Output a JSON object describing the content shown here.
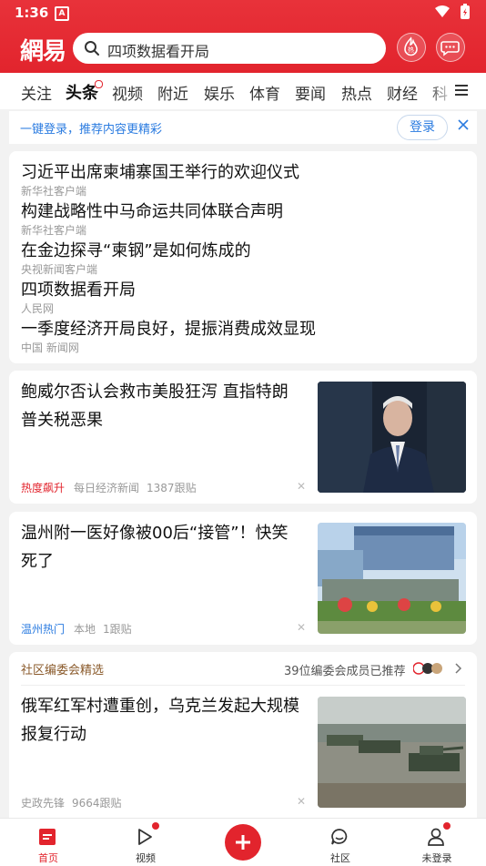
{
  "status_bar": {
    "time": "1:36",
    "notif_icon": "A"
  },
  "header": {
    "logo": "網易",
    "search_placeholder": "四项数据看开局",
    "hot_icon_label": "热"
  },
  "tabs": [
    "关注",
    "头条",
    "视频",
    "附近",
    "娱乐",
    "体育",
    "要闻",
    "热点",
    "财经",
    "科"
  ],
  "login_banner": {
    "text": "一键登录，推荐内容更精彩",
    "button": "登录"
  },
  "headlines": [
    {
      "title": "习近平出席柬埔寨国王举行的欢迎仪式",
      "source": "新华社客户端"
    },
    {
      "title": "构建战略性中马命运共同体联合声明",
      "source": "新华社客户端"
    },
    {
      "title": "在金边探寻“柬钢”是如何炼成的",
      "source": "央视新闻客户端"
    },
    {
      "title": "四项数据看开局",
      "source": "人民网"
    },
    {
      "title": "一季度经济开局良好，提振消费成效显现",
      "source": "中国 新闻网"
    }
  ],
  "news": [
    {
      "title": "鲍威尔否认会救市美股狂泻 直指特朗普关税恶果",
      "tag": "热度飙升",
      "source": "每日经济新闻",
      "comments": "1387跟贴"
    },
    {
      "title": "温州附一医好像被00后“接管”！快笑死了",
      "tag": "温州热门",
      "source": "本地",
      "comments": "1跟贴"
    }
  ],
  "community": {
    "label": "社区编委会精选",
    "recommend": "39位编委会成员已推荐",
    "title": "俄军红军村遭重创，乌克兰发起大规模报复行动",
    "source": "史政先锋",
    "comments": "9664跟贴"
  },
  "bottom_nav": [
    {
      "label": "首页"
    },
    {
      "label": "视频"
    },
    {
      "label": ""
    },
    {
      "label": "社区"
    },
    {
      "label": "未登录"
    }
  ],
  "colors": {
    "brand_red": "#e2242d",
    "link_blue": "#2a7be0"
  }
}
